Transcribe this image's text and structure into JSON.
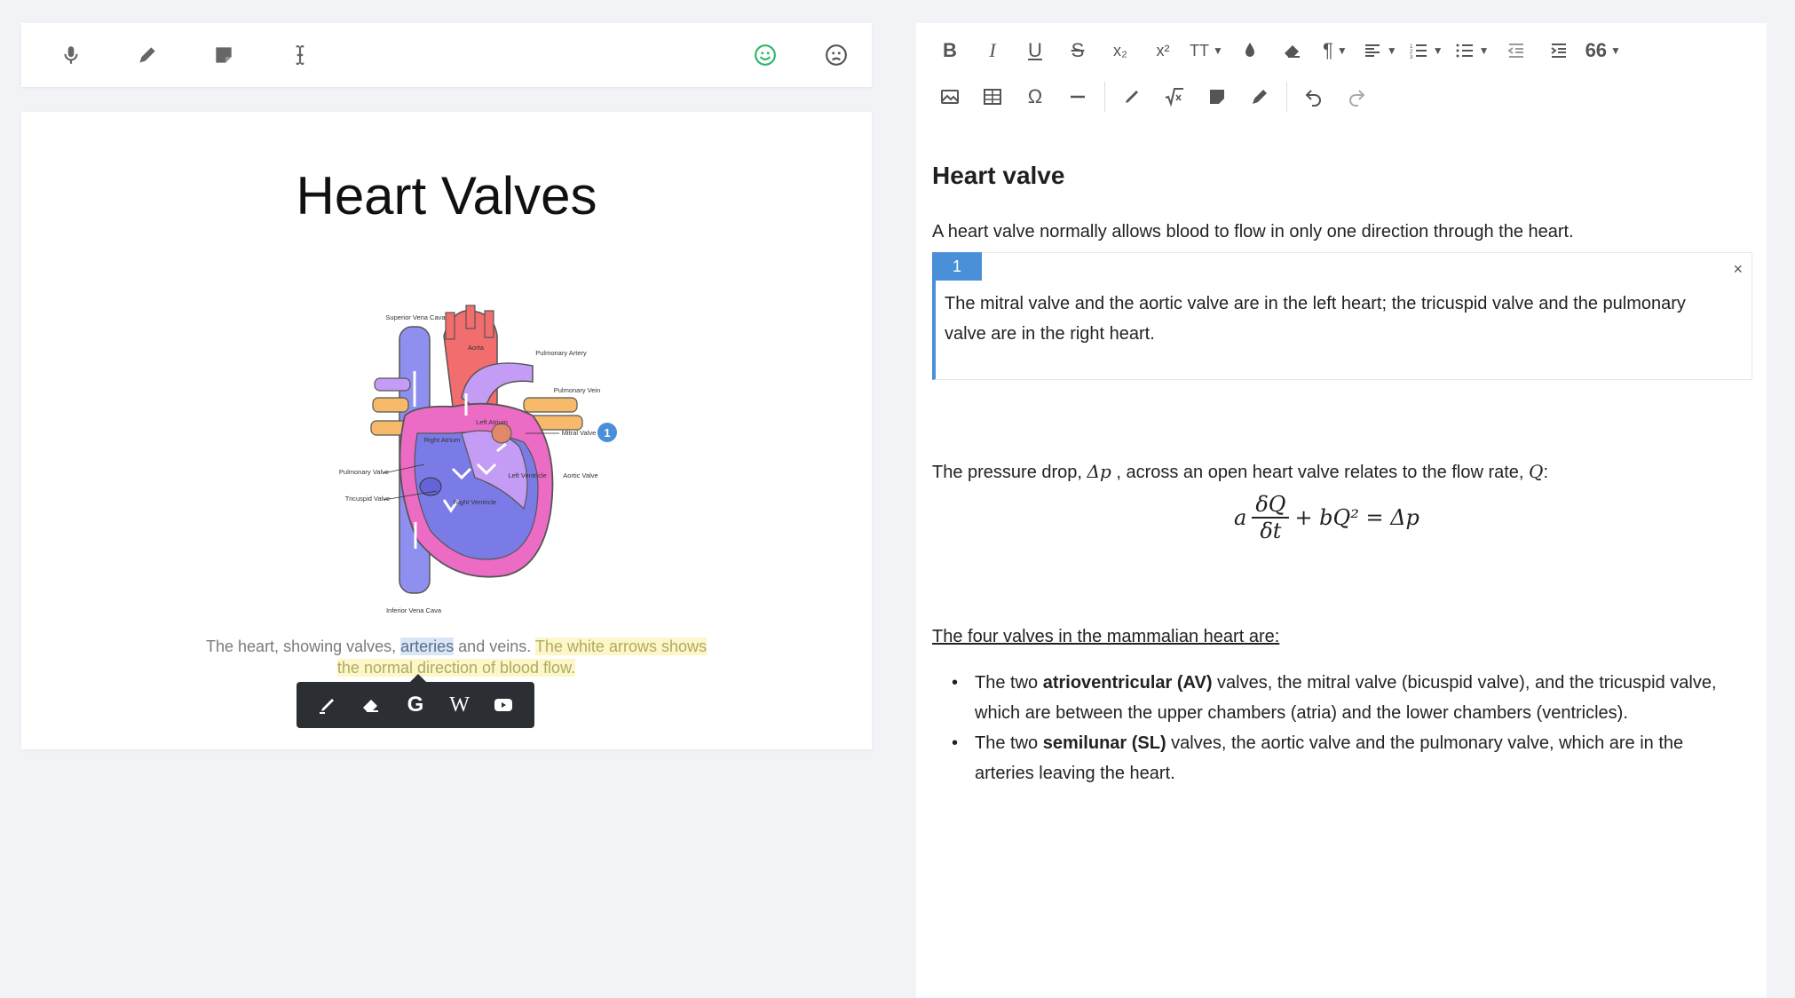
{
  "left_toolbar": {
    "icons": [
      "microphone-icon",
      "pencil-icon",
      "sticky-note-icon",
      "text-cursor-icon",
      "smiley-happy-icon",
      "smiley-sad-icon"
    ],
    "colors": {
      "happy": "#2fb56a",
      "sad": "#555555"
    }
  },
  "document": {
    "title": "Heart Valves",
    "caption": {
      "part1": "The heart, showing valves, ",
      "highlight_blue": "arteries",
      "part2": " and veins. ",
      "highlight_yellow_1": "The white arrows shows",
      "highlight_yellow_2": "the normal direction of blood flow."
    },
    "figure_labels": {
      "superior_vena_cava": "Superior Vena Cava",
      "aorta": "Aorta",
      "pulmonary_artery": "Pulmonary Artery",
      "pulmonary_vein": "Pulmonary Vein",
      "left_atrium": "Left Atrium",
      "right_atrium": "Right Atrium",
      "mitral_valve": "Mitral Valve",
      "aortic_valve": "Aortic Valve",
      "left_ventricle": "Left Ventricle",
      "right_ventricle": "Right Ventricle",
      "pulmonary_valve": "Pulmonary Valve",
      "tricuspid_valve": "Tricuspid Valve",
      "inferior_vena_cava": "Inferior Vena Cava",
      "annotation_marker": "1"
    },
    "popup_toolbar": {
      "icons": [
        "highlighter-icon",
        "eraser-icon",
        "google-icon",
        "wikipedia-icon",
        "youtube-icon"
      ],
      "google_label": "G",
      "wikipedia_label": "W"
    }
  },
  "editor": {
    "toolbar_row1": [
      "bold",
      "italic",
      "underline",
      "strikethrough",
      "subscript",
      "superscript",
      "font-size",
      "text-color",
      "clear-format",
      "paragraph",
      "align",
      "ordered-list",
      "unordered-list",
      "outdent",
      "indent",
      "blockquote"
    ],
    "toolbar_row2": [
      "image",
      "table",
      "special-char",
      "horizontal-rule",
      "highlighter",
      "math",
      "sticky-note",
      "pencil",
      "undo",
      "redo"
    ],
    "labels": {
      "bold": "B",
      "italic": "I",
      "underline": "U",
      "strike": "S",
      "sub": "x₂",
      "sup": "x²",
      "font_size": "TT",
      "omega": "Ω",
      "quote": "66"
    },
    "heading": "Heart valve",
    "intro": "A heart valve normally allows blood to flow in only one direction through the heart.",
    "note": {
      "number": "1",
      "close": "×",
      "text": "The mitral valve and the aortic valve are in the left heart; the tricuspid valve and the pulmonary valve are in the right heart."
    },
    "pressure": {
      "text1": "The pressure drop, ",
      "symbol1": "Δp",
      "text2": " , across an open heart valve relates to the flow rate, ",
      "symbol2": "Q",
      "text3": ":"
    },
    "formula": {
      "a": "a",
      "num": "δQ",
      "den": "δt",
      "rest": "+ bQ² = Δp"
    },
    "list_title": "The four valves in the mammalian heart are:",
    "list": [
      {
        "pre": "The two ",
        "bold": "atrioventricular (AV)",
        "post": " valves, the mitral valve (bicuspid valve), and the tricuspid valve, which are between the upper chambers (atria) and the lower chambers (ventricles)."
      },
      {
        "pre": "The two ",
        "bold": "semilunar (SL)",
        "post": " valves, the aortic valve and the pulmonary valve, which are in the arteries leaving the heart."
      }
    ],
    "accent_color": "#4a90d9"
  }
}
